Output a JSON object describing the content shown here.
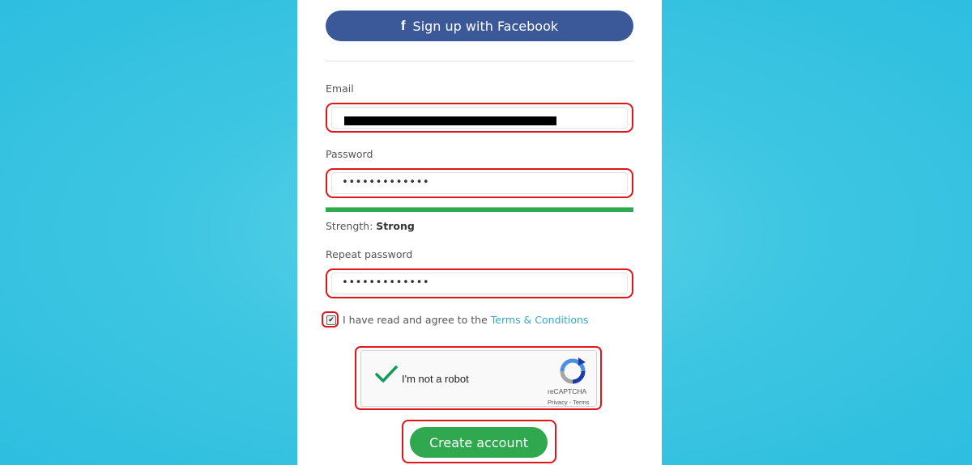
{
  "facebook": {
    "label": "Sign up with Facebook",
    "icon": "facebook-icon"
  },
  "email": {
    "label": "Email",
    "value_redacted": true
  },
  "password": {
    "label": "Password",
    "masked_value": "•••••••••••••"
  },
  "strength": {
    "label": "Strength:",
    "value": "Strong",
    "bar_color": "#2fa84f"
  },
  "repeat_password": {
    "label": "Repeat password",
    "masked_value": "•••••••••••••"
  },
  "terms": {
    "prefix": "I have read and agree to the",
    "link": "Terms & Conditions",
    "checked": true
  },
  "captcha": {
    "text": "I'm not a robot",
    "brand": "reCAPTCHA",
    "privacy": "Privacy - Terms"
  },
  "submit": {
    "label": "Create account"
  },
  "colors": {
    "facebook": "#3b5998",
    "primary": "#2fa84f",
    "highlight": "#e0161a",
    "link": "#3aa7c8",
    "background": "#33c1e0"
  }
}
